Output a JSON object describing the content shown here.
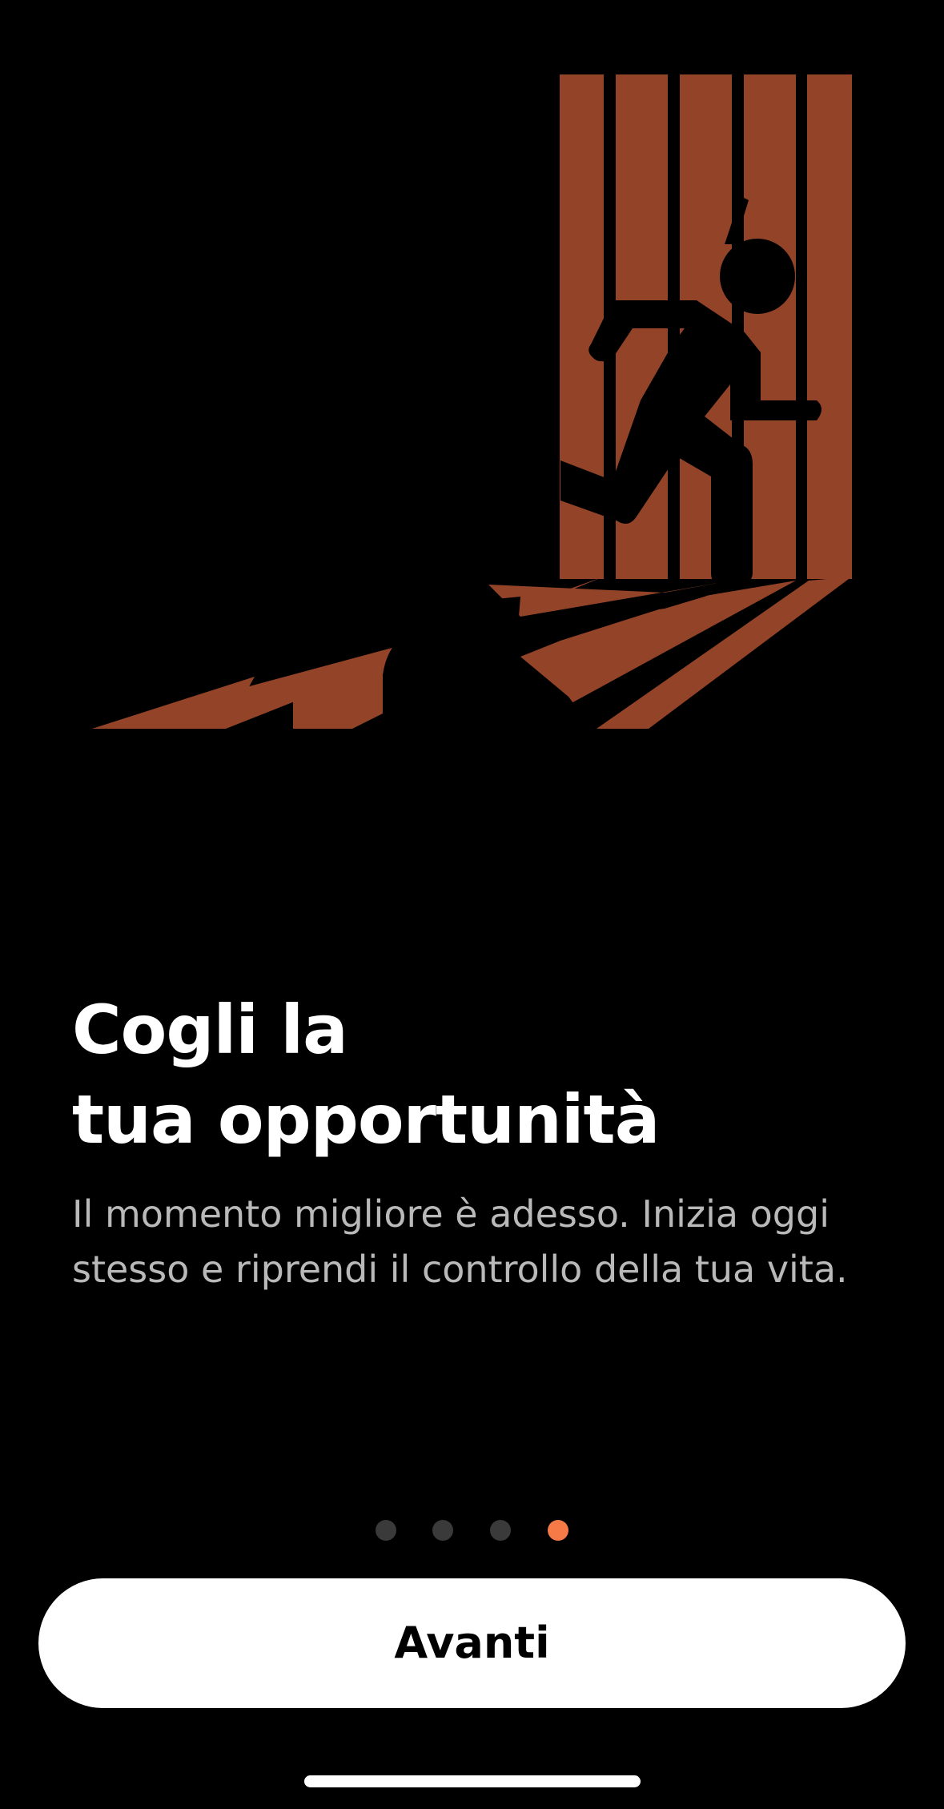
{
  "onboarding": {
    "headline_line1": "Cogli la",
    "headline_line2": "tua opportunità",
    "description": "Il momento migliore è adesso. Inizia oggi stesso e riprendi il controllo della tua vita.",
    "illustration_icon": "running-exit-figure-icon",
    "pagination": {
      "total": 4,
      "active_index": 3
    },
    "next_button_label": "Avanti"
  },
  "colors": {
    "background": "#000000",
    "accent": "#f57a47",
    "illustration_fill": "#934428",
    "dot_inactive": "#3a3a3a",
    "button_background": "#ffffff",
    "body_text": "#b9b9b9"
  }
}
